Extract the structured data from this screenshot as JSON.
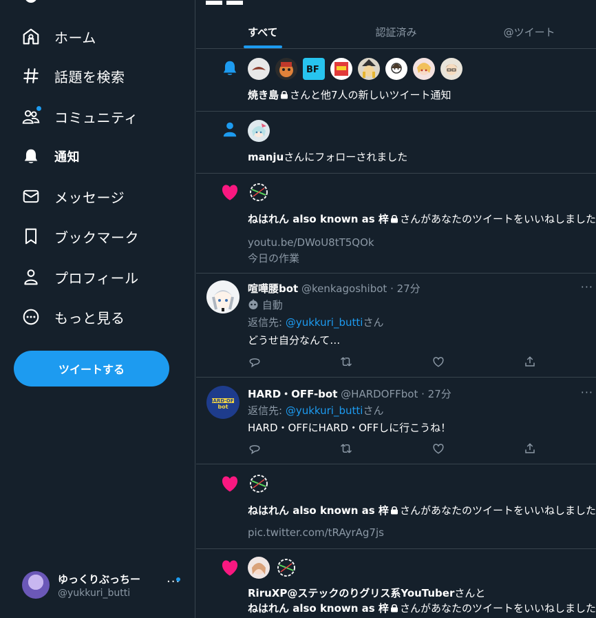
{
  "nav": {
    "home": "ホーム",
    "explore": "話題を検索",
    "communities": "コミュニティ",
    "notifications": "通知",
    "messages": "メッセージ",
    "bookmarks": "ブックマーク",
    "profile": "プロフィール",
    "more": "もっと見る",
    "tweet_button": "ツイートする"
  },
  "account": {
    "display_name": "ゆっくりぶっちー",
    "username": "@yukkuri_butti",
    "more": "···"
  },
  "tabs": [
    "すべて",
    "認証済み",
    "@ツイート"
  ],
  "notifications": [
    {
      "type": "bell",
      "name": "焼き島",
      "text": "さんと他7人の新しいツイート通知"
    },
    {
      "type": "follow",
      "name": "manju",
      "text": "さんにフォローされました"
    },
    {
      "type": "like",
      "name": "ねはれん also known as 梓",
      "text": "さんがあなたのツイートをいいねしました",
      "link": "youtu.be/DWoU8tT5QOk",
      "extra": "今日の作業"
    },
    {
      "type": "like2",
      "name": "ねはれん also known as 梓",
      "text": "さんがあなたのツイートをいいねしました",
      "link": "pic.twitter.com/tRAyrAg7js"
    },
    {
      "type": "like3",
      "name1": "RiruXP@ステックのりグリス系YouTuber",
      "text1": "さんと",
      "name2": "ねはれん also known as 梓",
      "text2": "さんがあなたのツイートをいいねしました"
    }
  ],
  "tweets": [
    {
      "name": "喧嘩腰bot",
      "handle": "@kenkagoshibot",
      "time": "· 27分",
      "auto": "自動",
      "reply_prefix": "返信先: ",
      "reply_to": "@yukkuri_butti",
      "reply_suffix": "さん",
      "body": "どうせ自分なんて…",
      "more": "···"
    },
    {
      "name": "HARD・OFF-bot",
      "handle": "@HARDOFFbot",
      "time": "· 27分",
      "reply_prefix": "返信先: ",
      "reply_to": "@yukkuri_butti",
      "reply_suffix": "さん",
      "body": "HARD・OFFにHARD・OFFしに行こうね！",
      "more": "···",
      "avatar_text": "HARD·OFF bot"
    }
  ],
  "colors": {
    "bg": "#15202b",
    "accent": "#1d9bf0",
    "like": "#f91880",
    "muted": "#8b98a5",
    "border": "#38444d"
  }
}
